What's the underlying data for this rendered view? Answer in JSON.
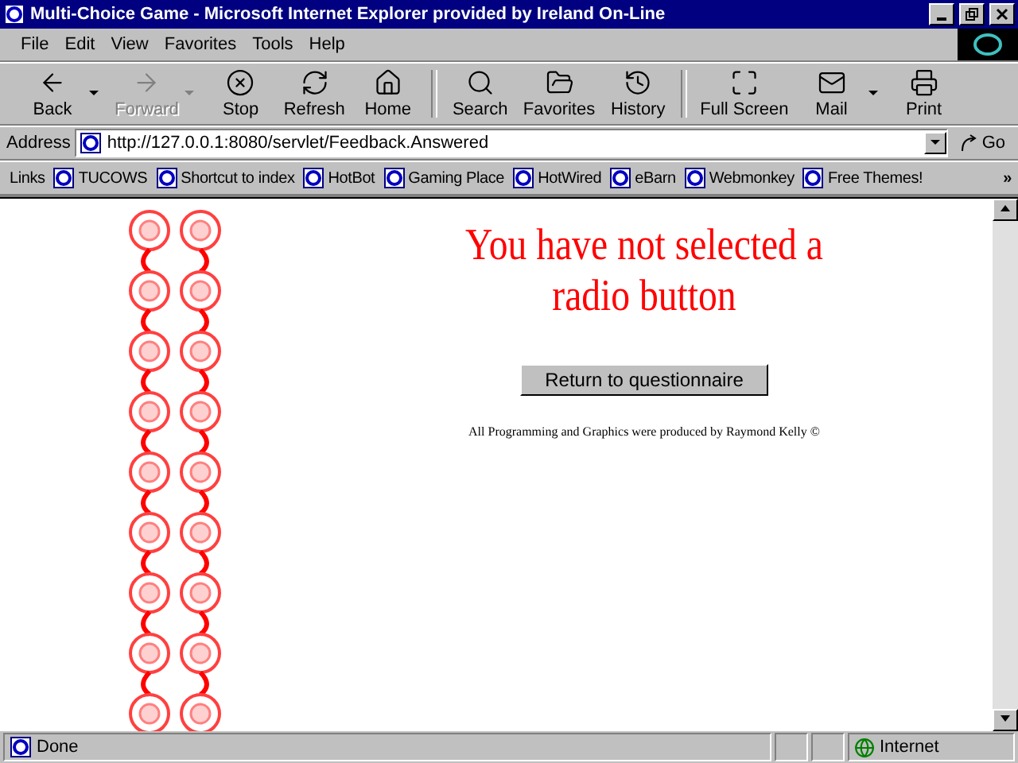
{
  "window": {
    "title": "Multi-Choice Game - Microsoft Internet Explorer provided by Ireland On-Line"
  },
  "menu": [
    "File",
    "Edit",
    "View",
    "Favorites",
    "Tools",
    "Help"
  ],
  "toolbar": [
    {
      "label": "Back",
      "kind": "back",
      "disabled": false,
      "dropdown": true
    },
    {
      "label": "Forward",
      "kind": "forward",
      "disabled": true,
      "dropdown": true
    },
    {
      "label": "Stop",
      "kind": "stop",
      "disabled": false,
      "dropdown": false
    },
    {
      "label": "Refresh",
      "kind": "refresh",
      "disabled": false,
      "dropdown": false
    },
    {
      "label": "Home",
      "kind": "home",
      "disabled": false,
      "dropdown": false
    },
    {
      "label": "Search",
      "kind": "search",
      "disabled": false,
      "dropdown": false
    },
    {
      "label": "Favorites",
      "kind": "favorites",
      "disabled": false,
      "dropdown": false
    },
    {
      "label": "History",
      "kind": "history",
      "disabled": false,
      "dropdown": false
    },
    {
      "label": "Full Screen",
      "kind": "fullscreen",
      "disabled": false,
      "dropdown": false
    },
    {
      "label": "Mail",
      "kind": "mail",
      "disabled": false,
      "dropdown": true
    },
    {
      "label": "Print",
      "kind": "print",
      "disabled": false,
      "dropdown": false
    }
  ],
  "address": {
    "label": "Address",
    "value": "http://127.0.0.1:8080/servlet/Feedback.Answered",
    "go": "Go"
  },
  "links": {
    "label": "Links",
    "items": [
      "TUCOWS",
      "Shortcut to index",
      "HotBot",
      "Gaming Place",
      "HotWired",
      "eBarn",
      "Webmonkey",
      "Free Themes!"
    ],
    "more": "»"
  },
  "page": {
    "heading": "You have not selected a radio button",
    "button": "Return to questionnaire",
    "credit": "All Programming and Graphics were produced by Raymond Kelly ©"
  },
  "status_bar": {
    "text": "Done",
    "zone": "Internet"
  }
}
